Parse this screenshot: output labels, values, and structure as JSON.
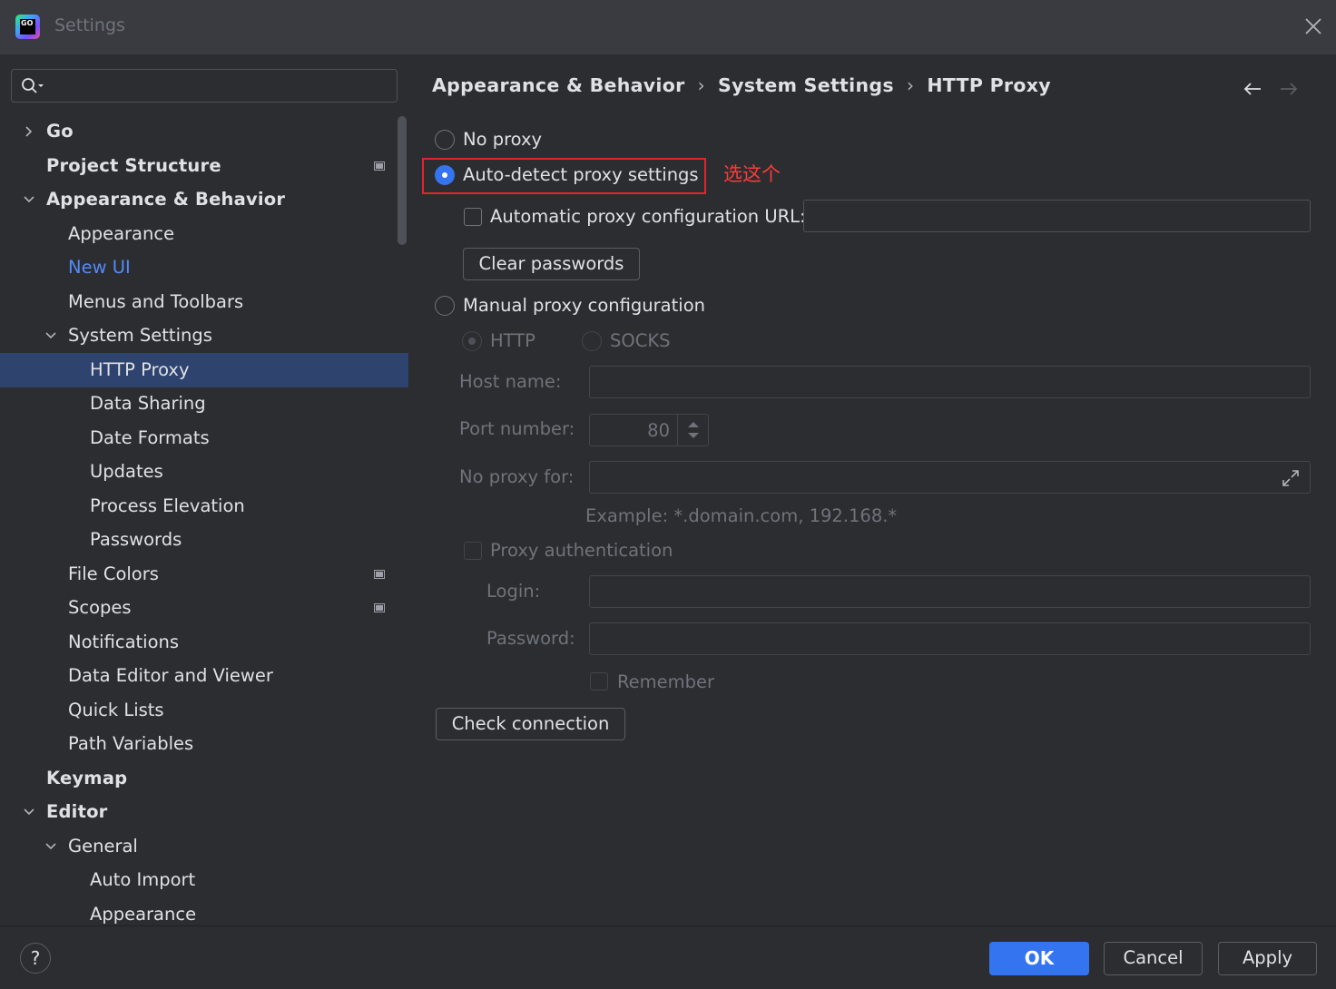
{
  "window": {
    "title": "Settings",
    "logo_text": "GO"
  },
  "sidebar": {
    "search_placeholder": "",
    "items": [
      {
        "label": "Go",
        "chevron": "right"
      },
      {
        "label": "Project Structure",
        "badge": true
      },
      {
        "label": "Appearance & Behavior",
        "chevron": "down"
      },
      {
        "label": "Appearance"
      },
      {
        "label": "New UI"
      },
      {
        "label": "Menus and Toolbars"
      },
      {
        "label": "System Settings",
        "chevron": "down"
      },
      {
        "label": "HTTP Proxy",
        "selected": true
      },
      {
        "label": "Data Sharing"
      },
      {
        "label": "Date Formats"
      },
      {
        "label": "Updates"
      },
      {
        "label": "Process Elevation"
      },
      {
        "label": "Passwords"
      },
      {
        "label": "File Colors",
        "badge": true
      },
      {
        "label": "Scopes",
        "badge": true
      },
      {
        "label": "Notifications"
      },
      {
        "label": "Data Editor and Viewer"
      },
      {
        "label": "Quick Lists"
      },
      {
        "label": "Path Variables"
      },
      {
        "label": "Keymap"
      },
      {
        "label": "Editor",
        "chevron": "down"
      },
      {
        "label": "General",
        "chevron": "down"
      },
      {
        "label": "Auto Import"
      },
      {
        "label": "Appearance"
      }
    ]
  },
  "breadcrumb": [
    "Appearance & Behavior",
    "System Settings",
    "HTTP Proxy"
  ],
  "breadcrumb_sep": "›",
  "proxy": {
    "no_proxy": "No proxy",
    "auto_detect": "Auto-detect proxy settings",
    "auto_detect_selected": true,
    "annotation": "选这个",
    "auto_config_url_label": "Automatic proxy configuration URL:",
    "auto_config_url_value": "",
    "clear_passwords": "Clear passwords",
    "manual": "Manual proxy configuration",
    "http": "HTTP",
    "socks": "SOCKS",
    "host_label": "Host name:",
    "host_value": "",
    "port_label": "Port number:",
    "port_value": "80",
    "no_proxy_for_label": "No proxy for:",
    "no_proxy_for_value": "",
    "example": "Example: *.domain.com, 192.168.*",
    "proxy_auth": "Proxy authentication",
    "login_label": "Login:",
    "login_value": "",
    "password_label": "Password:",
    "password_value": "",
    "remember": "Remember",
    "check_connection": "Check connection"
  },
  "footer": {
    "help": "?",
    "ok": "OK",
    "cancel": "Cancel",
    "apply": "Apply"
  },
  "colors": {
    "accent": "#3574f0",
    "selection": "#2e436e",
    "link": "#548af7",
    "annotation": "#e0262b"
  }
}
